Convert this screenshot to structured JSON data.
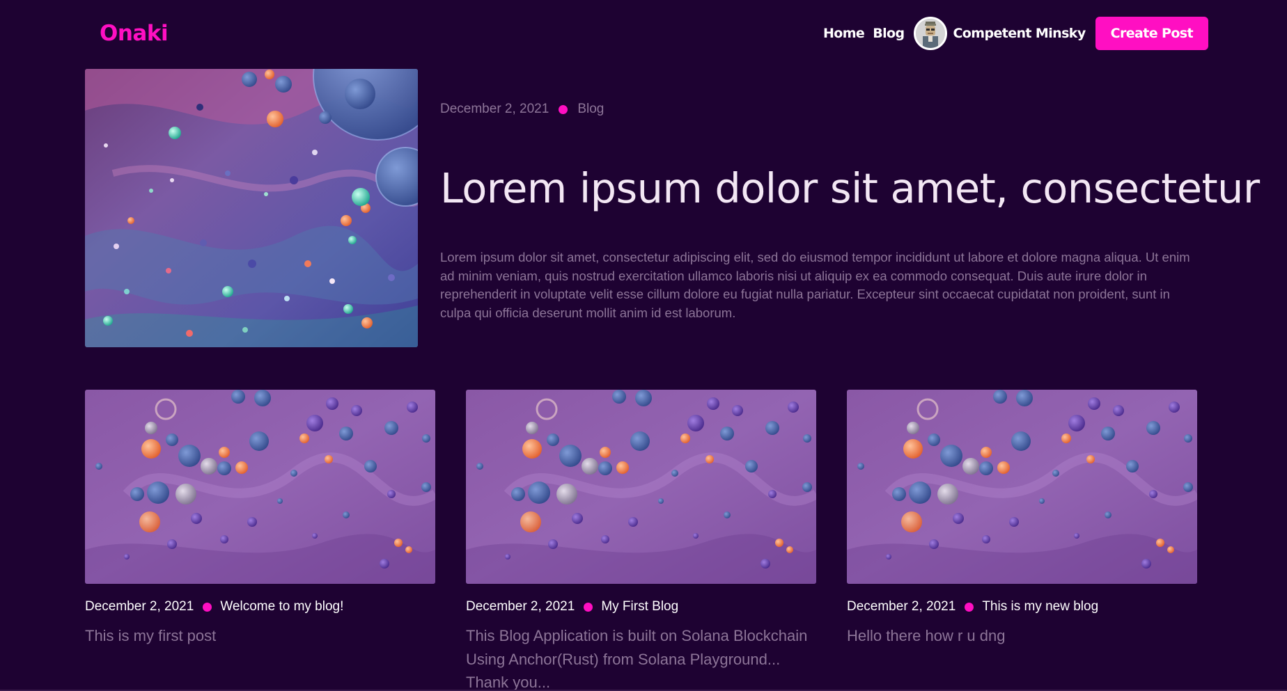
{
  "brand": "Onaki",
  "nav": {
    "home_label": "Home",
    "blog_label": "Blog",
    "user_name": "Competent Minsky",
    "create_post_label": "Create Post"
  },
  "featured": {
    "date": "December 2, 2021",
    "category": "Blog",
    "title": "Lorem ipsum dolor sit amet, consectetur",
    "excerpt": "Lorem ipsum dolor sit amet, consectetur adipiscing elit, sed do eiusmod tempor incididunt ut labore et dolore magna aliqua. Ut enim ad minim veniam, quis nostrud exercitation ullamco laboris nisi ut aliquip ex ea commodo consequat. Duis aute irure dolor in reprehenderit in voluptate velit esse cillum dolore eu fugiat nulla pariatur. Excepteur sint occaecat cupidatat non proident, sunt in culpa qui officia deserunt mollit anim id est laborum."
  },
  "posts": [
    {
      "date": "December 2, 2021",
      "title": "Welcome to my blog!",
      "excerpt": "This is my first post"
    },
    {
      "date": "December 2, 2021",
      "title": "My First Blog",
      "excerpt": "This Blog Application is built on Solana Blockchain Using Anchor(Rust) from Solana Playground... Thank you..."
    },
    {
      "date": "December 2, 2021",
      "title": "This is my new blog",
      "excerpt": "Hello there how r u dng"
    }
  ],
  "colors": {
    "background": "#1e0232",
    "accent": "#ff0fc2",
    "muted_text": "#8d7598"
  }
}
